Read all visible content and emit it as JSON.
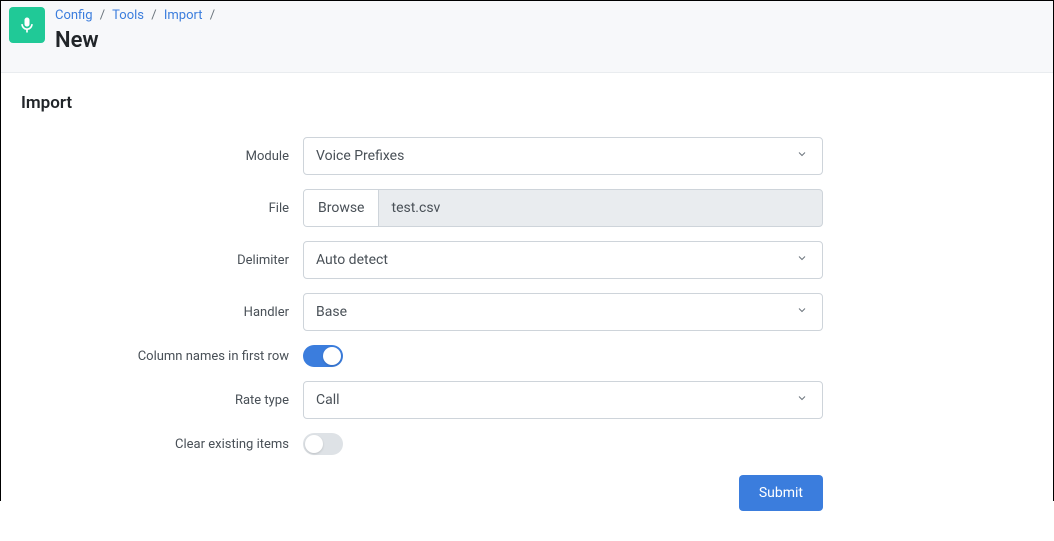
{
  "breadcrumb": {
    "items": [
      "Config",
      "Tools",
      "Import"
    ]
  },
  "page_title": "New",
  "panel_title": "Import",
  "form": {
    "module": {
      "label": "Module",
      "value": "Voice Prefixes"
    },
    "file": {
      "label": "File",
      "browse": "Browse",
      "filename": "test.csv"
    },
    "delimiter": {
      "label": "Delimiter",
      "value": "Auto detect"
    },
    "handler": {
      "label": "Handler",
      "value": "Base"
    },
    "col_first_row": {
      "label": "Column names in first row",
      "value": true
    },
    "rate_type": {
      "label": "Rate type",
      "value": "Call"
    },
    "clear_existing": {
      "label": "Clear existing items",
      "value": false
    }
  },
  "submit_label": "Submit"
}
